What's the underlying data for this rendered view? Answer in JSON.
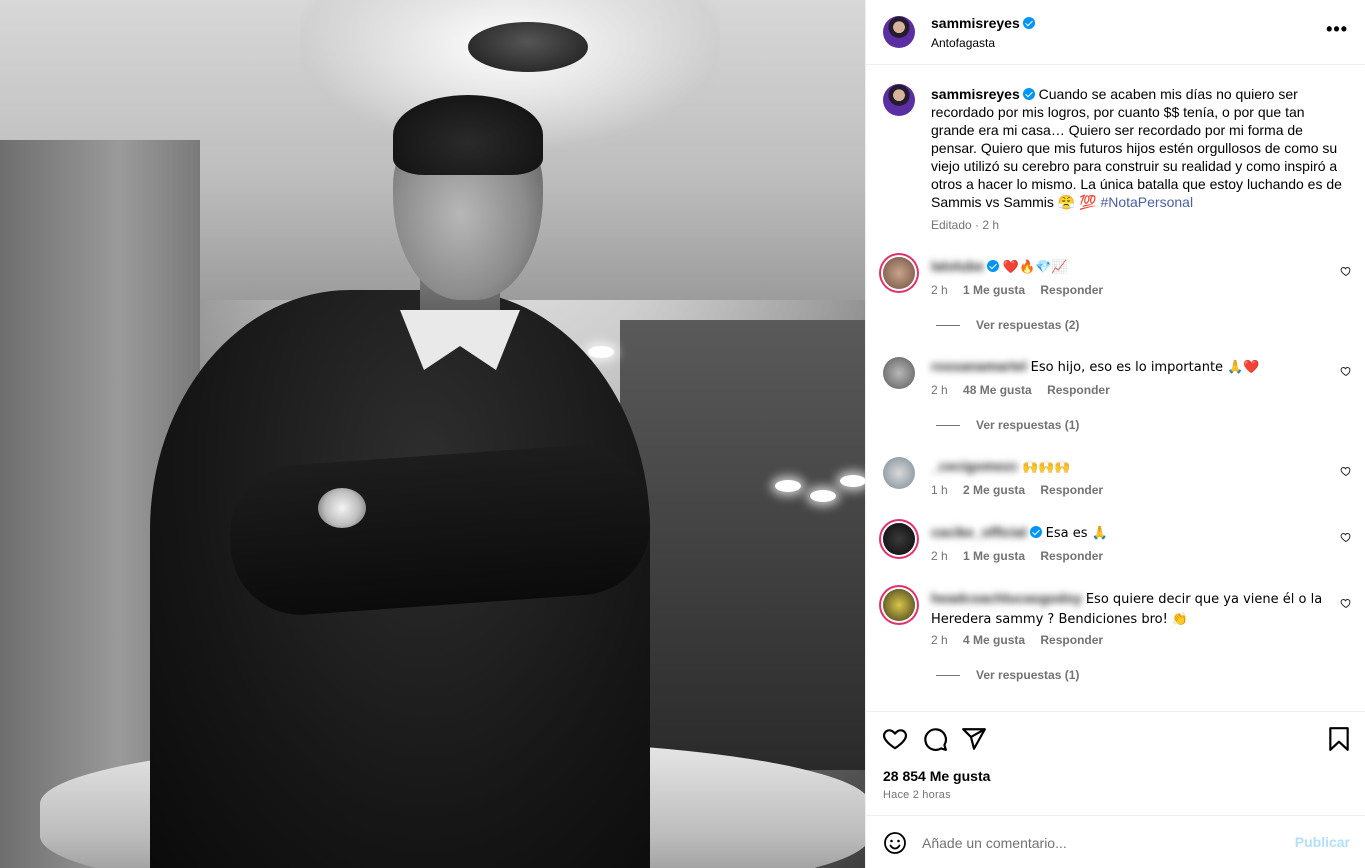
{
  "post": {
    "username": "sammisreyes",
    "location": "Antofagasta",
    "caption": "Cuando se acaben mis días no quiero ser recordado por mis logros, por cuanto $$ tenía, o por que tan grande era mi casa… Quiero ser recordado por mi forma de pensar. Quiero que mis futuros hijos estén orgullosos de como su viejo utilizó su cerebro para construir su realidad y como inspiró a otros a hacer lo mismo. La única batalla que estoy luchando es de Sammis vs Sammis 😤 💯",
    "hashtag": "#NotaPersonal",
    "edited": "Editado · 2 h",
    "more_icon": "more-options-icon"
  },
  "comments": [
    {
      "user": "lalolube",
      "text": "❤️🔥💎📈",
      "time": "2 h",
      "likes": "1 Me gusta",
      "reply": "Responder",
      "view_replies": "Ver respuestas (2)"
    },
    {
      "user": "rossanamartel",
      "text": "Eso hijo, eso es lo importante 🙏❤️",
      "time": "2 h",
      "likes": "48 Me gusta",
      "reply": "Responder",
      "view_replies": "Ver respuestas (1)"
    },
    {
      "user": "_cecigomezc",
      "text": "🙌🙌🙌",
      "time": "1 h",
      "likes": "2 Me gusta",
      "reply": "Responder"
    },
    {
      "user": "cacike_official",
      "text": "Esa es 🙏",
      "time": "2 h",
      "likes": "1 Me gusta",
      "reply": "Responder"
    },
    {
      "user": "headcoachlucasgodoy",
      "text": "Eso quiere decir que ya viene él o la Heredera sammy ? Bendiciones bro! 👏",
      "time": "2 h",
      "likes": "4 Me gusta",
      "reply": "Responder",
      "view_replies": "Ver respuestas (1)"
    }
  ],
  "footer": {
    "likes": "28 854 Me gusta",
    "time": "Hace 2 horas",
    "comment_placeholder": "Añade un comentario...",
    "post_label": "Publicar"
  },
  "icons": [
    "like-icon",
    "comment-icon",
    "share-icon",
    "save-icon",
    "emoji-icon",
    "verified-icon",
    "heart-icon"
  ],
  "colors": {
    "verified": "#0095f6",
    "hashtag": "#4a5fa8",
    "publish_disabled": "#b2dffc",
    "meta": "#737373"
  }
}
